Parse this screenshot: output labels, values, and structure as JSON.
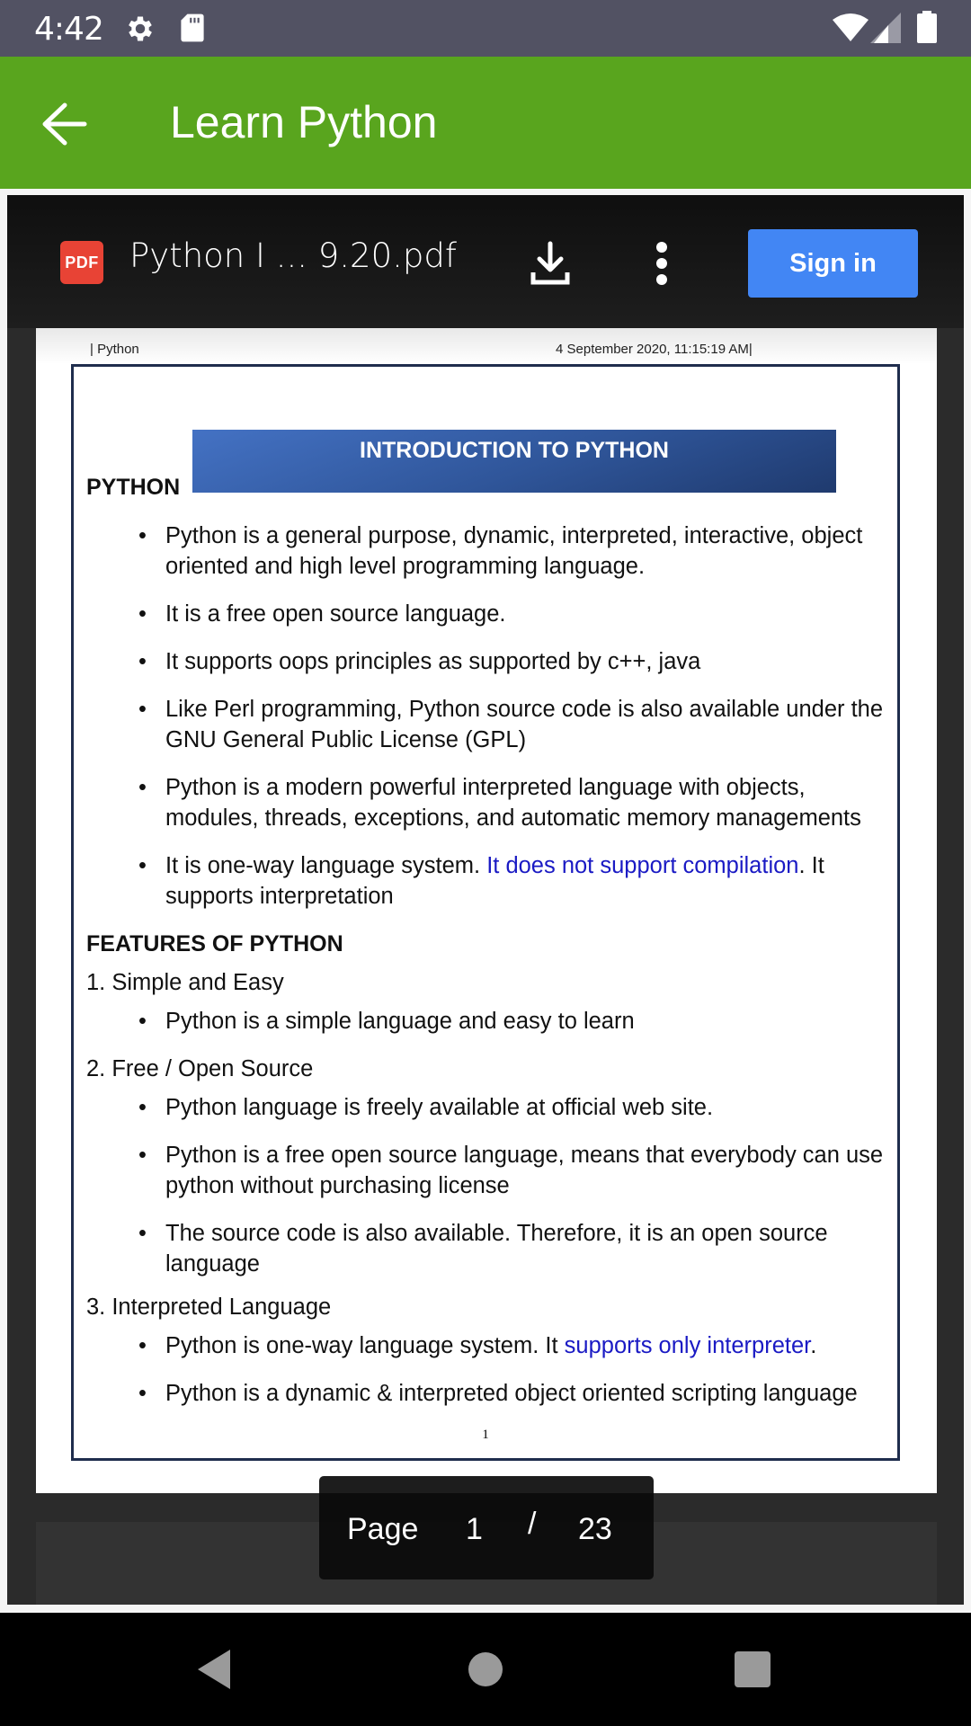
{
  "status_bar": {
    "time": "4:42",
    "icons": [
      "gear-icon",
      "sd-card-icon",
      "wifi-icon",
      "signal-icon",
      "battery-icon"
    ]
  },
  "app_bar": {
    "title": "Learn Python",
    "back_icon": "arrow-left-icon"
  },
  "viewer": {
    "file_badge": "PDF",
    "file_name": "Python I ... 9.20.pdf",
    "download_icon": "download-icon",
    "more_icon": "more-vertical-icon",
    "sign_in_label": "Sign in",
    "sign_in_color": "#4286f4"
  },
  "document": {
    "header_left": "| Python",
    "header_right": "4 September 2020, 11:15:19 AM|",
    "banner_title": "INTRODUCTION TO PYTHON",
    "section1": {
      "heading": "PYTHON",
      "bullets": [
        "Python is a general purpose, dynamic, interpreted, interactive, object oriented and high level programming language.",
        "It is a free open source language.",
        "It supports oops principles as supported by c++, java",
        "Like Perl programming, Python source code is also available under the GNU General Public License (GPL)",
        "Python is a modern powerful interpreted language with objects, modules, threads, exceptions, and automatic memory managements"
      ],
      "bullet6": {
        "before": "It is one-way language system. ",
        "link": "It does not support compilation",
        "after": ". It supports interpretation"
      }
    },
    "section2": {
      "heading": "FEATURES OF PYTHON",
      "items": [
        {
          "title": "1. Simple and Easy",
          "bullets": [
            "Python is a simple language and easy to learn"
          ]
        },
        {
          "title": "2. Free / Open Source",
          "bullets": [
            "Python language is freely available at official web site.",
            "Python is a free open source language, means that everybody can use python without purchasing license",
            "The source code is also available. Therefore, it is an open source language"
          ]
        },
        {
          "title": "3. Interpreted Language",
          "bullet1": {
            "before": "Python is one-way language system. It ",
            "link": "supports only interpreter",
            "after": "."
          },
          "bullet2": "Python is a dynamic & interpreted object oriented scripting language"
        }
      ]
    },
    "page_number": "1",
    "link_color": "#1a1ac4"
  },
  "page_indicator": {
    "label": "Page",
    "current": "1",
    "separator": "/",
    "total": "23"
  },
  "nav_bar": {
    "icons": [
      "back-triangle-icon",
      "home-circle-icon",
      "recents-square-icon"
    ]
  },
  "colors": {
    "status_bar": "#525263",
    "app_bar": "#59a51e",
    "pdf_badge": "#e84335"
  }
}
